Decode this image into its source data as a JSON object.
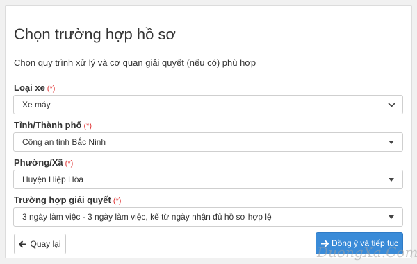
{
  "form": {
    "title": "Chọn trường hợp hồ sơ",
    "subtitle": "Chọn quy trình xử lý và cơ quan giải quyết (nếu có) phù hợp",
    "required_mark": "(*)",
    "fields": {
      "vehicle_type": {
        "label": "Loại xe",
        "value": "Xe máy"
      },
      "province": {
        "label": "Tỉnh/Thành phố",
        "value": "Công an tỉnh Bắc Ninh"
      },
      "ward": {
        "label": "Phường/Xã",
        "value": "Huyện Hiệp Hòa"
      },
      "case": {
        "label": "Trường hợp giải quyết",
        "value": "3 ngày làm việc - 3 ngày làm việc, kể từ ngày nhận đủ hồ sơ hợp lệ"
      }
    }
  },
  "actions": {
    "back_label": "Quay lại",
    "next_label": "Đồng ý và tiếp tục"
  },
  "watermark": "DuongXa.Com",
  "colors": {
    "primary": "#3a8bd8",
    "required": "#e03030",
    "background": "#f1f1f1"
  },
  "icons": {
    "back": "arrow-left-icon",
    "next": "arrow-right-icon",
    "dropdown": "chevron-down-icon"
  }
}
